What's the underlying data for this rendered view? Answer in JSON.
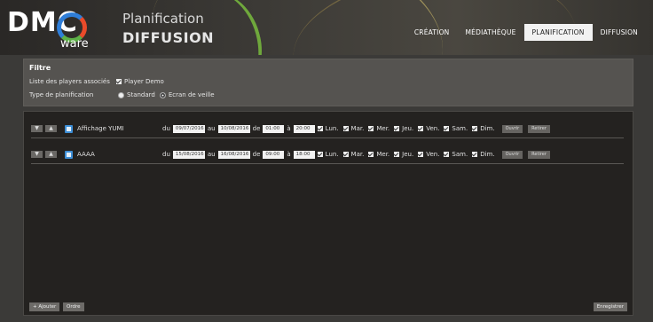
{
  "brand": {
    "dmc": "DMC",
    "ware": "ware"
  },
  "header": {
    "title_top": "Planification",
    "title_bottom": "DIFFUSION"
  },
  "nav": [
    {
      "label": "CRÉATION",
      "active": false
    },
    {
      "label": "MÉDIATHÈQUE",
      "active": false
    },
    {
      "label": "PLANIFICATION",
      "active": true
    },
    {
      "label": "DIFFUSION",
      "active": false
    }
  ],
  "filter": {
    "title": "Filtre",
    "players_label": "Liste des players associés",
    "player_name": "Player Demo",
    "type_label": "Type de planification",
    "type_options": [
      "Standard",
      "Ecran de veille"
    ]
  },
  "labels": {
    "du": "du",
    "au": "au",
    "de": "de",
    "a": "à"
  },
  "days": [
    "Lun.",
    "Mar.",
    "Mer.",
    "Jeu.",
    "Ven.",
    "Sam.",
    "Dim."
  ],
  "row_buttons": {
    "open": "Ouvrir",
    "remove": "Retirer"
  },
  "rows": [
    {
      "name": "Affichage YUMI",
      "from": "09/07/2016",
      "to": "10/08/2016",
      "start": "01:00",
      "end": "20:00"
    },
    {
      "name": "AAAA",
      "from": "15/08/2016",
      "to": "16/08/2016",
      "start": "09:00",
      "end": "18:00"
    }
  ],
  "footer": {
    "add": "+ Ajouter",
    "order": "Ordre",
    "save": "Enregistrer"
  }
}
